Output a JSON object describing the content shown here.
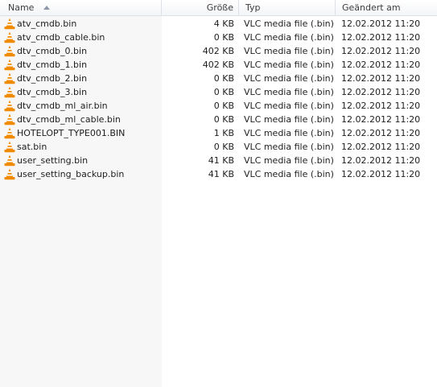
{
  "columns": {
    "name": "Name",
    "size": "Größe",
    "type": "Typ",
    "modified": "Geändert am",
    "sort_indicator": "sort-ascending-icon"
  },
  "colors": {
    "cone_orange": "#f08a00",
    "cone_stripe": "#ffffff"
  },
  "files": [
    {
      "name": "atv_cmdb.bin",
      "size": "4 KB",
      "type": "VLC media file (.bin)",
      "modified": "12.02.2012 11:20",
      "icon": "vlc-cone-icon"
    },
    {
      "name": "atv_cmdb_cable.bin",
      "size": "0 KB",
      "type": "VLC media file (.bin)",
      "modified": "12.02.2012 11:20",
      "icon": "vlc-cone-icon"
    },
    {
      "name": "dtv_cmdb_0.bin",
      "size": "402 KB",
      "type": "VLC media file (.bin)",
      "modified": "12.02.2012 11:20",
      "icon": "vlc-cone-icon"
    },
    {
      "name": "dtv_cmdb_1.bin",
      "size": "402 KB",
      "type": "VLC media file (.bin)",
      "modified": "12.02.2012 11:20",
      "icon": "vlc-cone-icon"
    },
    {
      "name": "dtv_cmdb_2.bin",
      "size": "0 KB",
      "type": "VLC media file (.bin)",
      "modified": "12.02.2012 11:20",
      "icon": "vlc-cone-icon"
    },
    {
      "name": "dtv_cmdb_3.bin",
      "size": "0 KB",
      "type": "VLC media file (.bin)",
      "modified": "12.02.2012 11:20",
      "icon": "vlc-cone-icon"
    },
    {
      "name": "dtv_cmdb_ml_air.bin",
      "size": "0 KB",
      "type": "VLC media file (.bin)",
      "modified": "12.02.2012 11:20",
      "icon": "vlc-cone-icon"
    },
    {
      "name": "dtv_cmdb_ml_cable.bin",
      "size": "0 KB",
      "type": "VLC media file (.bin)",
      "modified": "12.02.2012 11:20",
      "icon": "vlc-cone-icon"
    },
    {
      "name": "HOTELOPT_TYPE001.BIN",
      "size": "1 KB",
      "type": "VLC media file (.bin)",
      "modified": "12.02.2012 11:20",
      "icon": "vlc-cone-icon"
    },
    {
      "name": "sat.bin",
      "size": "0 KB",
      "type": "VLC media file (.bin)",
      "modified": "12.02.2012 11:20",
      "icon": "vlc-cone-icon"
    },
    {
      "name": "user_setting.bin",
      "size": "41 KB",
      "type": "VLC media file (.bin)",
      "modified": "12.02.2012 11:20",
      "icon": "vlc-cone-icon"
    },
    {
      "name": "user_setting_backup.bin",
      "size": "41 KB",
      "type": "VLC media file (.bin)",
      "modified": "12.02.2012 11:20",
      "icon": "vlc-cone-icon"
    }
  ]
}
